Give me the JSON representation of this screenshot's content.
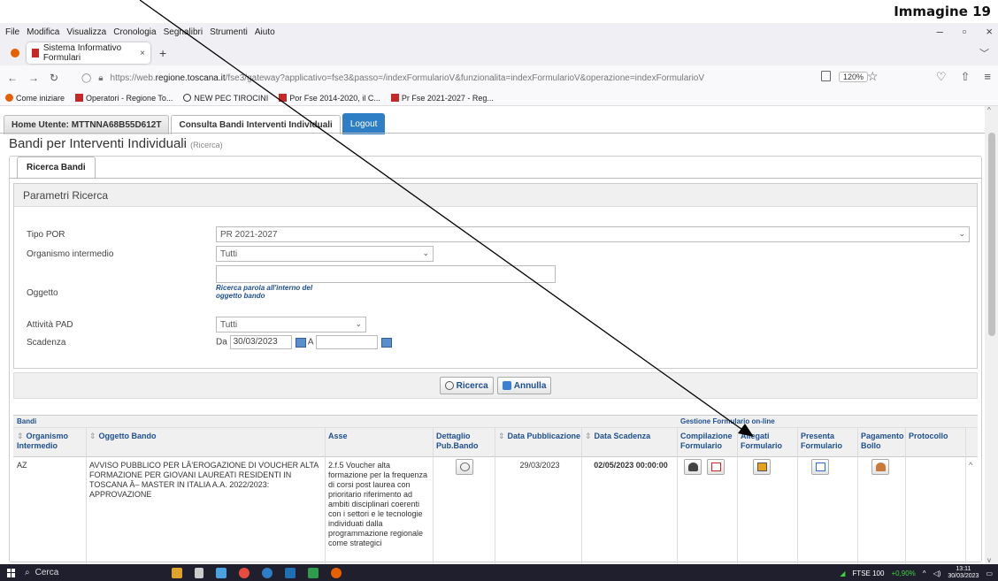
{
  "caption": "Immagine 19",
  "browser": {
    "menu": [
      "File",
      "Modifica",
      "Visualizza",
      "Cronologia",
      "Segnalibri",
      "Strumenti",
      "Aiuto"
    ],
    "tab_title": "Sistema Informativo Formulari",
    "url_prefix": "https://web.",
    "url_host": "regione.toscana.it",
    "url_rest": "/fse3/gateway?applicativo=fse3&passo=/indexFormularioV&funzionalita=indexFormularioV&operazione=indexFormularioV",
    "zoom": "120%",
    "bookmarks": [
      "Come iniziare",
      "Operatori - Regione To...",
      "NEW PEC TIROCINI",
      "Por Fse 2014-2020, il C...",
      "Pr Fse 2021-2027 - Reg..."
    ]
  },
  "app": {
    "tabs": [
      "Home Utente: MTTNNA68B55D612T",
      "Consulta Bandi Interventi Individuali",
      "Logout"
    ],
    "page_title": "Bandi per Interventi Individuali",
    "page_subtitle": "(Ricerca)",
    "inner_tab": "Ricerca Bandi",
    "panel_title": "Parametri Ricerca",
    "form": {
      "tipo_por_label": "Tipo POR",
      "tipo_por_value": "PR 2021-2027",
      "organismo_label": "Organismo intermedio",
      "organismo_value": "Tutti",
      "oggetto_label": "Oggetto",
      "oggetto_value": "",
      "oggetto_hint": "Ricerca parola all'interno del oggetto bando",
      "attivita_label": "Attività PAD",
      "attivita_value": "Tutti",
      "scadenza_label": "Scadenza",
      "scadenza_da": "Da",
      "scadenza_from": "30/03/2023",
      "scadenza_a": "A",
      "scadenza_to": ""
    },
    "buttons": {
      "search": "Ricerca",
      "cancel": "Annulla"
    },
    "table": {
      "title": "Bandi",
      "group_title": "Gestione Formulario on-line",
      "headers": {
        "organismo": "Organismo Intermedio",
        "oggetto": "Oggetto Bando",
        "asse": "Asse",
        "dettaglio": "Dettaglio Pub.Bando",
        "pubblicazione": "Data Pubblicazione",
        "scadenza": "Data Scadenza",
        "compilazione": "Compilazione Formulario",
        "allegati": "Allegati Formulario",
        "presenta": "Presenta Formulario",
        "pagamento": "Pagamento Bollo",
        "protocollo": "Protocollo"
      },
      "row": {
        "organismo": "AZ",
        "oggetto": "AVVISO PUBBLICO PER LÂ'EROGAZIONE DI VOUCHER ALTA FORMAZIONE PER GIOVANI LAUREATI RESIDENTI IN TOSCANA Â– MASTER IN ITALIA A.A. 2022/2023: APPROVAZIONE",
        "asse": "2.f.5 Voucher alta formazione per la frequenza di corsi post laurea con prioritario riferimento ad ambiti disciplinari coerenti con i settori e le tecnologie individuati dalla programmazione regionale come strategici",
        "pubblicazione": "29/03/2023",
        "scadenza": "02/05/2023 00:00:00"
      }
    }
  },
  "taskbar": {
    "search": "Cerca",
    "ticker": "FTSE 100",
    "ticker_change": "+0,90%",
    "time": "13:11",
    "date": "30/03/2023"
  }
}
